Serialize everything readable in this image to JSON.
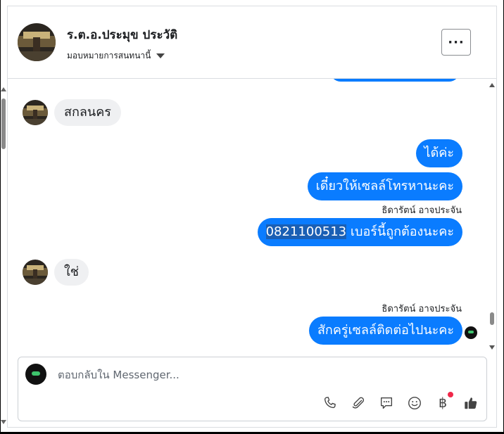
{
  "header": {
    "contact_name": "ร.ต.อ.ประมุข ประวัติ",
    "assign_label": "มอบหมายการสนทนานี้",
    "more_label": "···"
  },
  "messages": {
    "m1": "สกลนคร",
    "m2": "ได้ค่ะ",
    "m3": "เดี๋ยวให้เซลล์โทรหานะคะ",
    "sender_1": "ธิดารัตน์ อาจประจัน",
    "m4_phone": "0821100513",
    "m4_rest": " เบอร์นี้ถูกต้องนะคะ",
    "m5": "ใช่",
    "sender_2": "ธิดารัตน์ อาจประจัน",
    "m6": "สักครู่เซลล์ติดต่อไปนะคะ"
  },
  "composer": {
    "placeholder": "ตอบกลับใน Messenger...",
    "baht_symbol": "฿"
  },
  "icons": {
    "phone": "phone-icon",
    "attach": "paperclip-icon",
    "chat": "chat-bubble-icon",
    "emoji": "smiley-icon",
    "payment": "baht-icon",
    "like": "thumbs-up-icon"
  },
  "colors": {
    "outgoing_bubble": "#0a7cff",
    "incoming_bubble": "#eff0f2",
    "notification_dot": "#f02849"
  }
}
